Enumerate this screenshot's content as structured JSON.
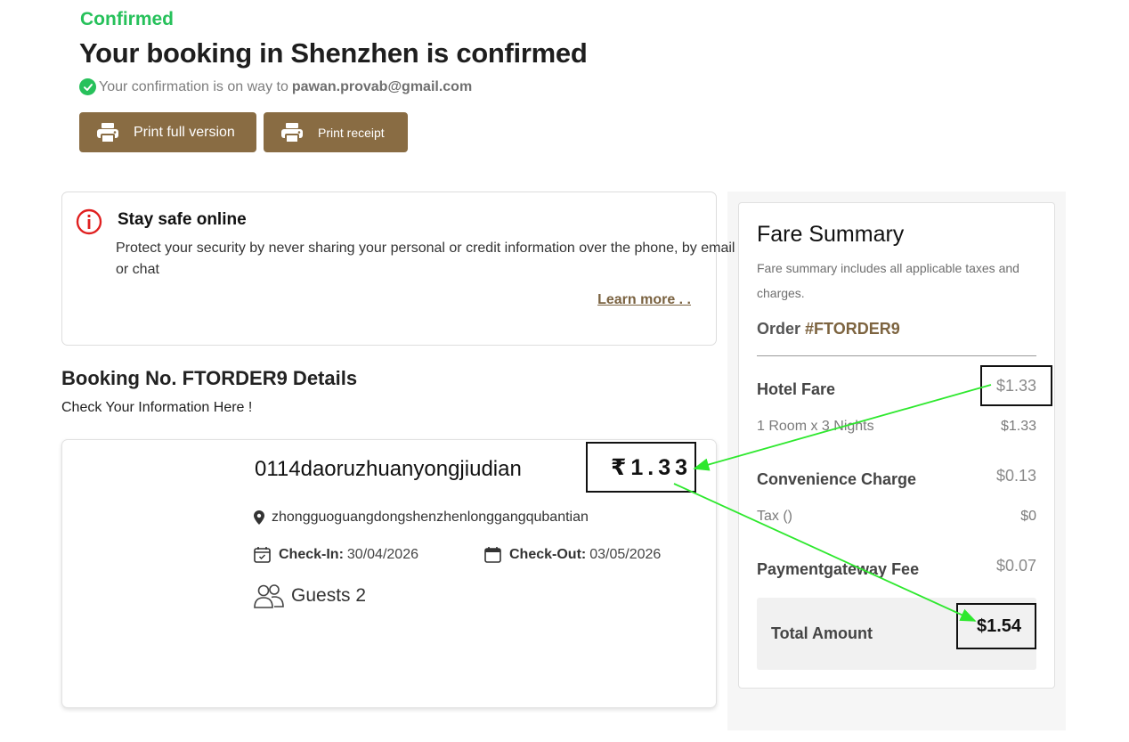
{
  "header": {
    "status": "Confirmed",
    "title": "Your booking in Shenzhen is confirmed",
    "confirmation_prefix": "Your confirmation is on way to",
    "email": "pawan.provab@gmail.com"
  },
  "actions": {
    "print_full": "Print full version",
    "print_receipt": "Print receipt"
  },
  "safety": {
    "title": "Stay safe online",
    "text": "Protect your security by never sharing your personal or credit information over the phone, by email or chat",
    "learn_more": "Learn more . ."
  },
  "booking": {
    "heading": "Booking No. FTORDER9 Details",
    "subheading": "Check Your Information Here !",
    "hotel_name": "0114daoruzhuanyongjiudian",
    "price": "₹1.33",
    "address": "zhongguoguangdongshenzhenlonggangqubantian",
    "checkin_label": "Check-In:",
    "checkin_date": "30/04/2026",
    "checkout_label": "Check-Out:",
    "checkout_date": "03/05/2026",
    "guests": "Guests 2"
  },
  "fare": {
    "title": "Fare Summary",
    "description": "Fare summary includes all applicable taxes and charges.",
    "order_label": "Order",
    "order_number": "#FTORDER9",
    "hotel_fare_label": "Hotel Fare",
    "hotel_fare_value": "$1.33",
    "room_nights_label": "1 Room x 3 Nights",
    "room_nights_value": "$1.33",
    "convenience_label": "Convenience Charge",
    "convenience_value": "$0.13",
    "tax_label": "Tax ()",
    "tax_value": "$0",
    "gateway_label": "Paymentgateway Fee",
    "gateway_value": "$0.07",
    "total_label": "Total Amount",
    "total_value": "$1.54"
  },
  "colors": {
    "success": "#27c15b",
    "brand": "#896c43",
    "alert": "#e02020",
    "annotation_arrow": "#2ee82e"
  }
}
